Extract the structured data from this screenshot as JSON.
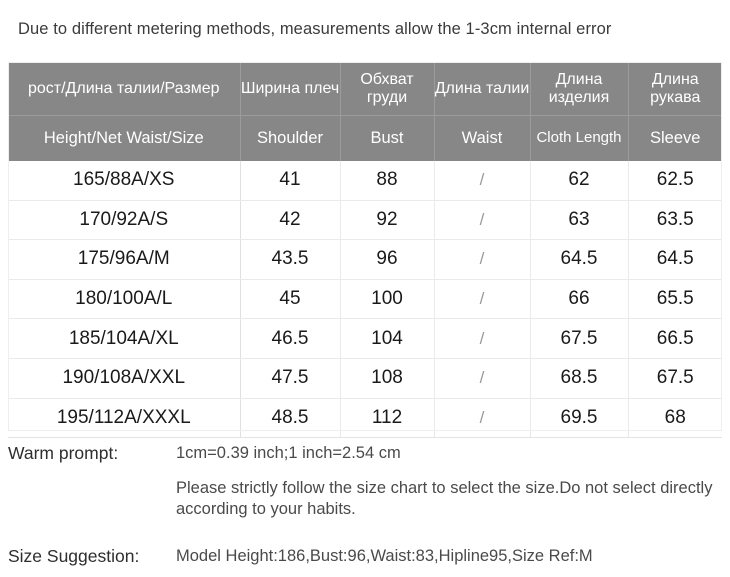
{
  "header_note": "Due to different metering methods, measurements allow the 1-3cm internal error",
  "table": {
    "columns_ru": [
      "рост/Длина талии/Размер",
      "Ширина плеч",
      "Обхват груди",
      "Длина талии",
      "Длина изделия",
      "Длина рукава"
    ],
    "columns_en": [
      "Height/Net  Waist/Size",
      "Shoulder",
      "Bust",
      "Waist",
      "Cloth Length",
      "Sleeve"
    ],
    "rows": [
      {
        "size": "165/88A/XS",
        "shoulder": "41",
        "bust": "88",
        "waist": "/",
        "cloth_length": "62",
        "sleeve": "62.5"
      },
      {
        "size": "170/92A/S",
        "shoulder": "42",
        "bust": "92",
        "waist": "/",
        "cloth_length": "63",
        "sleeve": "63.5"
      },
      {
        "size": "175/96A/M",
        "shoulder": "43.5",
        "bust": "96",
        "waist": "/",
        "cloth_length": "64.5",
        "sleeve": "64.5"
      },
      {
        "size": "180/100A/L",
        "shoulder": "45",
        "bust": "100",
        "waist": "/",
        "cloth_length": "66",
        "sleeve": "65.5"
      },
      {
        "size": "185/104A/XL",
        "shoulder": "46.5",
        "bust": "104",
        "waist": "/",
        "cloth_length": "67.5",
        "sleeve": "66.5"
      },
      {
        "size": "190/108A/XXL",
        "shoulder": "47.5",
        "bust": "108",
        "waist": "/",
        "cloth_length": "68.5",
        "sleeve": "67.5"
      },
      {
        "size": "195/112A/XXXL",
        "shoulder": "48.5",
        "bust": "112",
        "waist": "/",
        "cloth_length": "69.5",
        "sleeve": "68"
      }
    ]
  },
  "notes": {
    "warm_prompt_label": "Warm prompt:",
    "warm_prompt_value": "1cm=0.39 inch;1 inch=2.54 cm",
    "warm_prompt_detail": "Please strictly follow the size chart  to select the size.Do not select directly according to your habits.",
    "size_suggestion_label": "Size Suggestion:",
    "size_suggestion_value": "Model Height:186,Bust:96,Waist:83,Hipline95,Size Ref:M"
  },
  "colors": {
    "header_gray": "#878787",
    "header_text": "#ffffff",
    "grid_line": "#eaeaea",
    "body_text": "#1a1a1a",
    "muted_text": "#9a9a9a"
  }
}
